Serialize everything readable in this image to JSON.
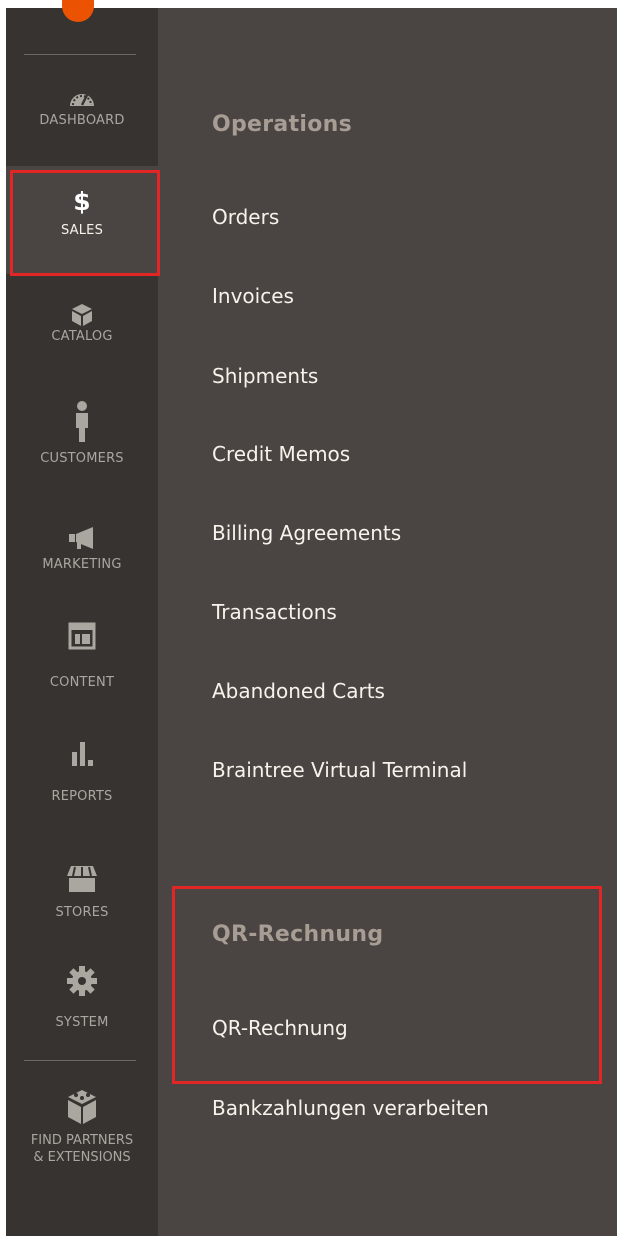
{
  "sidebar": {
    "items": [
      {
        "label": "DASHBOARD",
        "icon": "dashboard-gauge-icon"
      },
      {
        "label": "SALES",
        "icon": "dollar-icon",
        "glyph": "$",
        "active": true
      },
      {
        "label": "CATALOG",
        "icon": "box-icon"
      },
      {
        "label": "CUSTOMERS",
        "icon": "person-icon"
      },
      {
        "label": "MARKETING",
        "icon": "megaphone-icon"
      },
      {
        "label": "CONTENT",
        "icon": "layout-icon"
      },
      {
        "label": "REPORTS",
        "icon": "bar-chart-icon"
      },
      {
        "label": "STORES",
        "icon": "storefront-icon"
      },
      {
        "label": "SYSTEM",
        "icon": "gear-icon"
      },
      {
        "label_line1": "FIND PARTNERS",
        "label_line2": "& EXTENSIONS",
        "icon": "blocks-icon"
      }
    ]
  },
  "submenu": {
    "operations": {
      "title": "Operations",
      "links": [
        "Orders",
        "Invoices",
        "Shipments",
        "Credit Memos",
        "Billing Agreements",
        "Transactions",
        "Abandoned Carts",
        "Braintree Virtual Terminal"
      ]
    },
    "qr": {
      "title": "QR-Rechnung",
      "links": [
        "QR-Rechnung",
        "Bankzahlungen verarbeiten"
      ]
    }
  },
  "colors": {
    "sidebar_bg": "#373330",
    "panel_bg": "#4a4542",
    "highlight": "#e22626",
    "brand": "#eb5202"
  }
}
